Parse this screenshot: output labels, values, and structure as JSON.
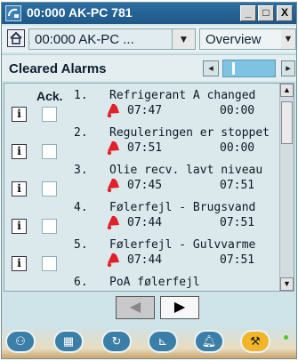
{
  "window": {
    "title": "00:000 AK-PC 781",
    "minimize_label": "_",
    "maximize_label": "□",
    "close_label": "X"
  },
  "toolbar": {
    "site_value": "00:000 AK-PC ...",
    "view_value": "Overview"
  },
  "section": {
    "title": "Cleared Alarms"
  },
  "list": {
    "ack_header": "Ack.",
    "info_label": "i",
    "alarms": [
      {
        "number": "1.",
        "name": "Refrigerant A changed",
        "time1": "07:47",
        "time2": "00:00"
      },
      {
        "number": "2.",
        "name": "Reguleringen er stoppet",
        "time1": "07:51",
        "time2": "00:00"
      },
      {
        "number": "3.",
        "name": "Olie recv. lavt niveau",
        "time1": "07:45",
        "time2": "07:51"
      },
      {
        "number": "4.",
        "name": "Følerfejl - Brugsvand",
        "time1": "07:44",
        "time2": "07:51"
      },
      {
        "number": "5.",
        "name": "Følerfejl - Gulvvarme",
        "time1": "07:44",
        "time2": "07:51"
      },
      {
        "number": "6.",
        "name": "PoA følerfejl",
        "time1": "",
        "time2": ""
      }
    ]
  },
  "bottom_tools": [
    {
      "icon": "controllers-icon"
    },
    {
      "icon": "grid-icon"
    },
    {
      "icon": "refresh-icon"
    },
    {
      "icon": "chart-icon"
    },
    {
      "icon": "alarm-bell-icon"
    },
    {
      "icon": "wrench-icon",
      "active": true
    }
  ],
  "colors": {
    "titlebar": "#1f5888",
    "background": "#cfe4e8",
    "alarm_bell": "#e0202a",
    "active_tool": "#f2b52a",
    "tool": "#3b7fa8",
    "status_led": "#55c530"
  }
}
